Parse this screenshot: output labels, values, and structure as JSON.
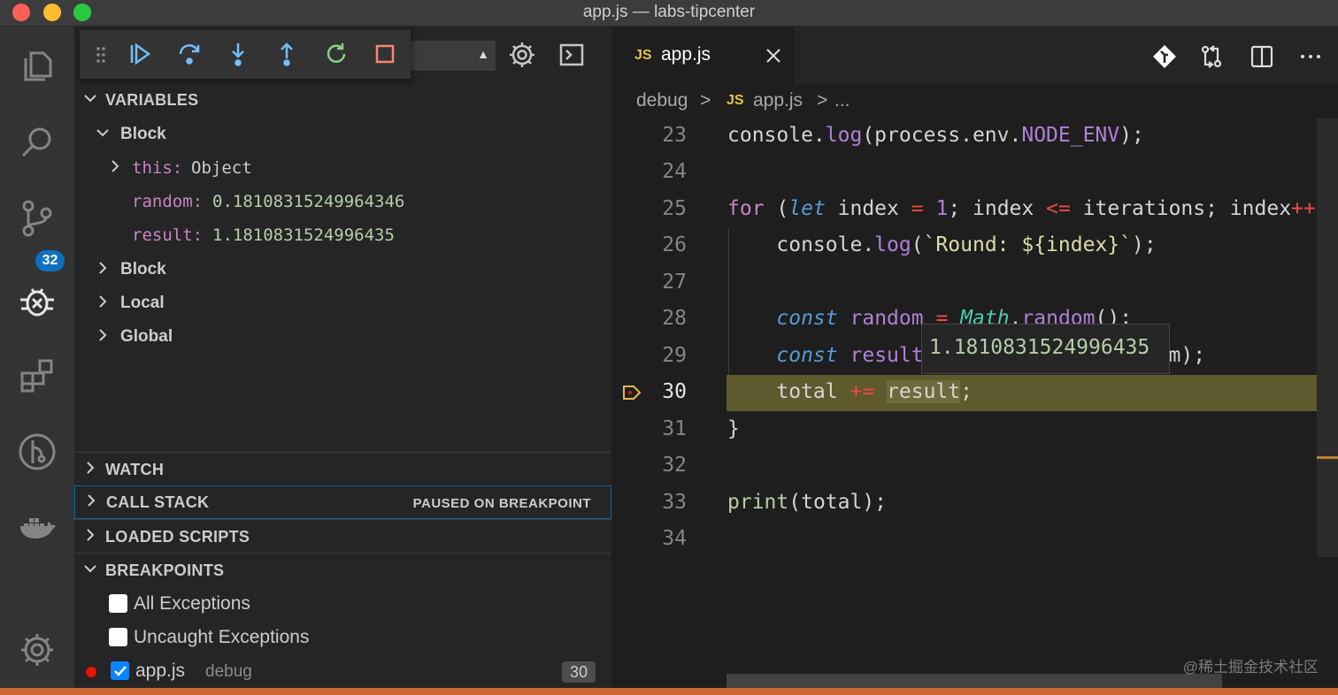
{
  "window": {
    "title": "app.js — labs-tipcenter",
    "traffic_lights": [
      "#ff5f57",
      "#febc2e",
      "#28c840"
    ]
  },
  "activity_bar": {
    "items": [
      "files-icon",
      "search-icon",
      "source-control-icon",
      "debug-icon",
      "extensions-icon",
      "git-graph-icon",
      "docker-icon"
    ],
    "source_control_badge": "32",
    "settings_icon": "gear-icon"
  },
  "debug_toolbar": {
    "buttons": [
      "continue",
      "step-over",
      "step-into",
      "step-out",
      "restart",
      "stop"
    ]
  },
  "sidebar": {
    "variables": {
      "header": "VARIABLES",
      "scopes": [
        {
          "label": "Block",
          "expanded": true
        },
        {
          "label": "Block",
          "expanded": false
        },
        {
          "label": "Local",
          "expanded": false
        },
        {
          "label": "Global",
          "expanded": false
        }
      ],
      "this_name": "this:",
      "this_value": "Object",
      "random_name": "random:",
      "random_value": "0.18108315249964346",
      "result_name": "result:",
      "result_value": "1.1810831524996435"
    },
    "watch": {
      "header": "WATCH"
    },
    "call_stack": {
      "header": "CALL STACK",
      "status": "PAUSED ON BREAKPOINT"
    },
    "loaded_scripts": {
      "header": "LOADED SCRIPTS"
    },
    "breakpoints": {
      "header": "BREAKPOINTS",
      "all_exceptions": {
        "label": "All Exceptions",
        "checked": false
      },
      "uncaught_exceptions": {
        "label": "Uncaught Exceptions",
        "checked": false
      },
      "file_bp": {
        "file": "app.js",
        "folder": "debug",
        "line": "30",
        "checked": true
      }
    }
  },
  "editor": {
    "tab": {
      "lang": "JS",
      "name": "app.js"
    },
    "breadcrumb": {
      "folder": "debug",
      "sep": ">",
      "lang": "JS",
      "file": "app.js",
      "more": "..."
    },
    "line_numbers": [
      "23",
      "24",
      "25",
      "26",
      "27",
      "28",
      "29",
      "30",
      "31",
      "32",
      "33",
      "34"
    ],
    "current_line": "30",
    "hover_value": "1.1810831524996435"
  },
  "watermark": "@稀土掘金技术社区",
  "colors": {
    "accent_blue": "#0e70c0",
    "breakpoint_red": "#e51400",
    "status_bar": "#cc6633",
    "current_line_highlight": "#5e5a2e"
  }
}
